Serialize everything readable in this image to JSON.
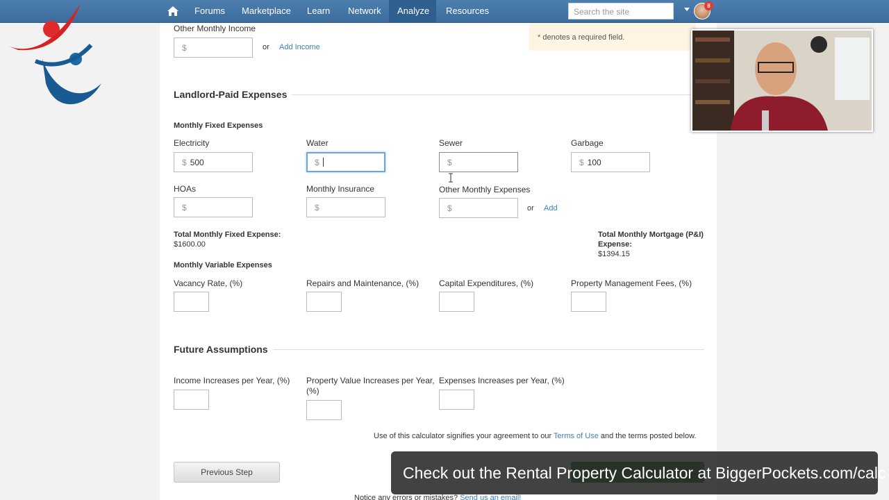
{
  "nav": {
    "items": [
      "Forums",
      "Marketplace",
      "Learn",
      "Network",
      "Analyze",
      "Resources"
    ],
    "active": "Analyze",
    "search_placeholder": "Search the site",
    "notification_count": "8"
  },
  "notice": {
    "asterisk": "*",
    "text": "denotes a required field."
  },
  "income": {
    "other_label": "Other Monthly Income",
    "or": "or",
    "add_link": "Add Income"
  },
  "expenses": {
    "section_title": "Landlord-Paid Expenses",
    "fixed_title": "Monthly Fixed Expenses",
    "currency": "$",
    "fields": {
      "electricity": {
        "label": "Electricity",
        "value": "500"
      },
      "water": {
        "label": "Water",
        "value": ""
      },
      "sewer": {
        "label": "Sewer",
        "value": ""
      },
      "garbage": {
        "label": "Garbage",
        "value": "100"
      },
      "hoas": {
        "label": "HOAs",
        "value": ""
      },
      "insurance": {
        "label": "Monthly Insurance",
        "value": ""
      },
      "other": {
        "label": "Other Monthly Expenses",
        "value": ""
      }
    },
    "or": "or",
    "add_link": "Add",
    "total_fixed_label": "Total Monthly Fixed Expense:",
    "total_fixed_value": "$1600.00",
    "total_mortgage_label_1": "Total Monthly Mortgage (P&I)",
    "total_mortgage_label_2": "Expense:",
    "total_mortgage_value": "$1394.15",
    "variable_title": "Monthly Variable Expenses",
    "variable": {
      "vacancy": "Vacancy Rate, (%)",
      "repairs": "Repairs and Maintenance, (%)",
      "capex": "Capital Expenditures, (%)",
      "management": "Property Management Fees, (%)"
    }
  },
  "future": {
    "section_title": "Future Assumptions",
    "income_inc": "Income Increases per Year, (%)",
    "property_inc_1": "Property Value Increases per Year,",
    "property_inc_2": "(%)",
    "expenses_inc": "Expenses Increases per Year, (%)"
  },
  "terms": {
    "pre": "Use of this calculator signifies your agreement to our ",
    "link": "Terms of Use",
    "post": " and the terms posted below."
  },
  "buttons": {
    "previous": "Previous Step"
  },
  "bottom_note": {
    "pre": "Notice any errors or mistakes? ",
    "link": "Send us an email!"
  },
  "caption": "Check out the Rental Property Calculator at BiggerPockets.com/calc",
  "colors": {
    "nav": "#3b6c9c",
    "link": "#3a80b8",
    "focus": "#6fa6d8",
    "next_button": "#2e7d32"
  }
}
